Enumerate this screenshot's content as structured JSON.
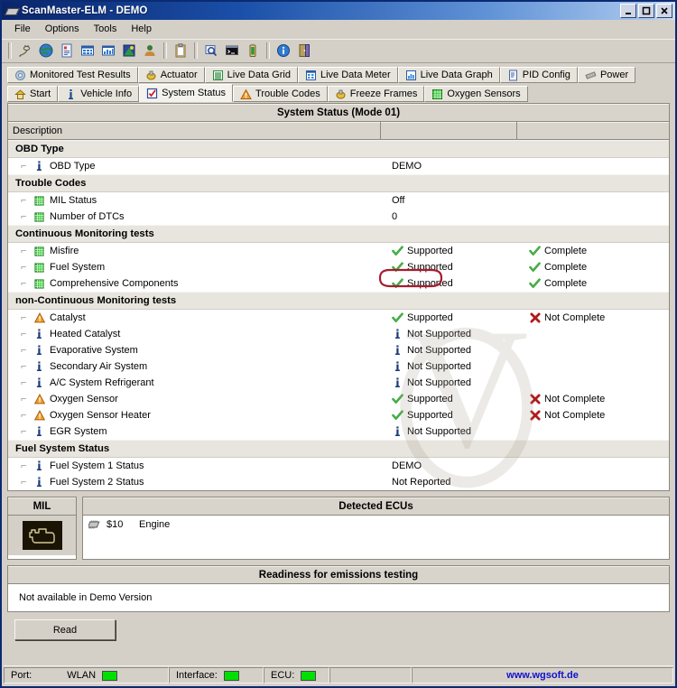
{
  "window": {
    "title": "ScanMaster-ELM - DEMO",
    "icon": "chip-icon",
    "controls": [
      {
        "name": "minimize-button",
        "label": "_"
      },
      {
        "name": "maximize-button",
        "label": "□"
      },
      {
        "name": "close-button",
        "label": "✕"
      }
    ]
  },
  "menubar": {
    "items": [
      {
        "label": "File",
        "name": "menu-file"
      },
      {
        "label": "Options",
        "name": "menu-options"
      },
      {
        "label": "Tools",
        "name": "menu-tools"
      },
      {
        "label": "Help",
        "name": "menu-help"
      }
    ]
  },
  "toolbar": {
    "buttons": [
      {
        "name": "connect-icon",
        "title": "Connect"
      },
      {
        "name": "globe-icon",
        "title": "Internet"
      },
      {
        "name": "report-icon",
        "title": "Report"
      },
      {
        "name": "data-grid-icon",
        "title": "Live Data Grid"
      },
      {
        "name": "data-graph-icon",
        "title": "Live Data Graph"
      },
      {
        "name": "chart-icon",
        "title": "Chart"
      },
      {
        "name": "user-icon",
        "title": "User"
      },
      {
        "name": "clipboard-icon",
        "title": "Clipboard"
      },
      {
        "name": "search-icon",
        "title": "Find"
      },
      {
        "name": "terminal-icon",
        "title": "Terminal"
      },
      {
        "name": "battery-icon",
        "title": "Battery"
      },
      {
        "name": "info-icon",
        "title": "Info"
      },
      {
        "name": "exit-icon",
        "title": "Exit"
      }
    ]
  },
  "tabs": {
    "row1": [
      {
        "label": "Monitored Test Results",
        "icon": "gear-icon",
        "selected": false
      },
      {
        "label": "Actuator",
        "icon": "actuator-icon",
        "selected": false
      },
      {
        "label": "Live Data Grid",
        "icon": "grid-icon",
        "selected": false
      },
      {
        "label": "Live Data Meter",
        "icon": "meter-icon",
        "selected": false
      },
      {
        "label": "Live Data Graph",
        "icon": "graph-icon",
        "selected": false
      },
      {
        "label": "PID Config",
        "icon": "pid-icon",
        "selected": false
      },
      {
        "label": "Power",
        "icon": "power-icon",
        "selected": false
      }
    ],
    "row2": [
      {
        "label": "Start",
        "icon": "home-icon",
        "selected": false
      },
      {
        "label": "Vehicle Info",
        "icon": "info-pin-icon",
        "selected": false
      },
      {
        "label": "System Status",
        "icon": "checkbox-icon",
        "selected": true
      },
      {
        "label": "Trouble Codes",
        "icon": "warning-icon",
        "selected": false
      },
      {
        "label": "Freeze Frames",
        "icon": "actuator-icon",
        "selected": false
      },
      {
        "label": "Oxygen Sensors",
        "icon": "green-grid-icon",
        "selected": false
      }
    ]
  },
  "status_panel": {
    "title": "System Status (Mode 01)",
    "columns": [
      "Description",
      "",
      ""
    ],
    "annotation": {
      "name": "demo-highlight-oval",
      "color": "#a51d2d"
    },
    "groups": [
      {
        "name": "OBD Type",
        "rows": [
          {
            "icon": "info-pin-icon",
            "desc": "OBD Type",
            "value1": "DEMO",
            "value1_icon": "",
            "value2": "",
            "value2_icon": ""
          }
        ]
      },
      {
        "name": "Trouble Codes",
        "rows": [
          {
            "icon": "green-grid-icon",
            "desc": "MIL Status",
            "value1": "Off",
            "value1_icon": "",
            "value2": "",
            "value2_icon": ""
          },
          {
            "icon": "green-grid-icon",
            "desc": "Number of DTCs",
            "value1": "0",
            "value1_icon": "",
            "value2": "",
            "value2_icon": ""
          }
        ]
      },
      {
        "name": "Continuous Monitoring tests",
        "rows": [
          {
            "icon": "green-grid-icon",
            "desc": "Misfire",
            "value1": "Supported",
            "value1_icon": "check-icon",
            "value2": "Complete",
            "value2_icon": "check-icon"
          },
          {
            "icon": "green-grid-icon",
            "desc": "Fuel System",
            "value1": "Supported",
            "value1_icon": "check-icon",
            "value2": "Complete",
            "value2_icon": "check-icon"
          },
          {
            "icon": "green-grid-icon",
            "desc": "Comprehensive Components",
            "value1": "Supported",
            "value1_icon": "check-icon",
            "value2": "Complete",
            "value2_icon": "check-icon"
          }
        ]
      },
      {
        "name": "non-Continuous Monitoring tests",
        "rows": [
          {
            "icon": "warning-icon",
            "desc": "Catalyst",
            "value1": "Supported",
            "value1_icon": "check-icon",
            "value2": "Not Complete",
            "value2_icon": "cross-icon"
          },
          {
            "icon": "info-pin-icon",
            "desc": "Heated Catalyst",
            "value1": "Not Supported",
            "value1_icon": "info-pin-icon",
            "value2": "",
            "value2_icon": ""
          },
          {
            "icon": "info-pin-icon",
            "desc": "Evaporative System",
            "value1": "Not Supported",
            "value1_icon": "info-pin-icon",
            "value2": "",
            "value2_icon": ""
          },
          {
            "icon": "info-pin-icon",
            "desc": "Secondary Air System",
            "value1": "Not Supported",
            "value1_icon": "info-pin-icon",
            "value2": "",
            "value2_icon": ""
          },
          {
            "icon": "info-pin-icon",
            "desc": "A/C System Refrigerant",
            "value1": "Not Supported",
            "value1_icon": "info-pin-icon",
            "value2": "",
            "value2_icon": ""
          },
          {
            "icon": "warning-icon",
            "desc": "Oxygen Sensor",
            "value1": "Supported",
            "value1_icon": "check-icon",
            "value2": "Not Complete",
            "value2_icon": "cross-icon"
          },
          {
            "icon": "warning-icon",
            "desc": "Oxygen Sensor Heater",
            "value1": "Supported",
            "value1_icon": "check-icon",
            "value2": "Not Complete",
            "value2_icon": "cross-icon"
          },
          {
            "icon": "info-pin-icon",
            "desc": "EGR System",
            "value1": "Not Supported",
            "value1_icon": "info-pin-icon",
            "value2": "",
            "value2_icon": ""
          }
        ]
      },
      {
        "name": "Fuel System Status",
        "rows": [
          {
            "icon": "info-pin-icon",
            "desc": "Fuel System 1 Status",
            "value1": "DEMO",
            "value1_icon": "",
            "value2": "",
            "value2_icon": ""
          },
          {
            "icon": "info-pin-icon",
            "desc": "Fuel System 2 Status",
            "value1": "Not Reported",
            "value1_icon": "",
            "value2": "",
            "value2_icon": ""
          }
        ]
      }
    ]
  },
  "mil": {
    "title": "MIL",
    "lamp_icon": "engine-lamp-icon",
    "lamp_state": "off"
  },
  "ecus": {
    "title": "Detected ECUs",
    "rows": [
      {
        "icon": "chip-icon",
        "id": "$10",
        "name": "Engine"
      }
    ]
  },
  "readiness": {
    "title": "Readiness for emissions testing",
    "text": "Not available in Demo Version"
  },
  "actions": {
    "read_label": "Read"
  },
  "statusbar": {
    "port_label": "Port:",
    "port_value": "WLAN",
    "interface_label": "Interface:",
    "ecu_label": "ECU:",
    "url": "www.wgsoft.de",
    "led_color": "#00e000"
  }
}
